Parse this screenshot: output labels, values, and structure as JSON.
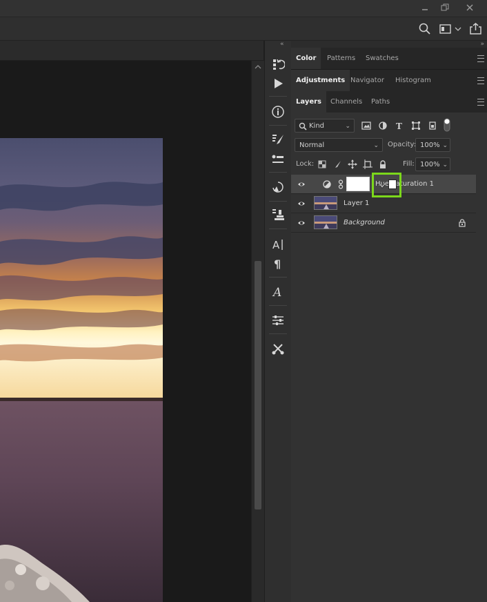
{
  "window": {
    "controls": [
      "minimize-icon",
      "restore-icon",
      "close-icon"
    ]
  },
  "options_bar": {
    "icons": [
      "search-icon",
      "workspace-icon",
      "chevron-down-icon",
      "share-icon"
    ]
  },
  "panel_groups": [
    {
      "tabs": [
        "Color",
        "Patterns",
        "Swatches"
      ],
      "active": 0
    },
    {
      "tabs": [
        "Adjustments",
        "Navigator",
        "Histogram"
      ],
      "active": 0
    },
    {
      "tabs": [
        "Layers",
        "Channels",
        "Paths"
      ],
      "active": 0
    }
  ],
  "layers_panel": {
    "filter_kind": "Kind",
    "blend_mode": "Normal",
    "opacity_label": "Opacity:",
    "opacity_value": "100%",
    "lock_label": "Lock:",
    "fill_label": "Fill:",
    "fill_value": "100%",
    "layers": [
      {
        "name": "Hue/Saturation 1",
        "visible": true,
        "selected": true,
        "type": "adjustment"
      },
      {
        "name": "Layer 1",
        "visible": true,
        "selected": false,
        "type": "pixel"
      },
      {
        "name": "Background",
        "visible": true,
        "selected": false,
        "type": "background",
        "locked": true
      }
    ]
  },
  "colors": {
    "highlight": "#7cd81b",
    "panel_bg": "#323232",
    "selected_row": "#474747"
  },
  "toolbar_icons": [
    "history-icon",
    "play-actions-icon",
    "info-icon",
    "brush-settings-icon",
    "brush-presets-icon",
    "clone-source-icon",
    "tool-presets-icon",
    "character-icon",
    "paragraph-icon",
    "glyphs-icon",
    "properties-icon",
    "tools-icon"
  ]
}
